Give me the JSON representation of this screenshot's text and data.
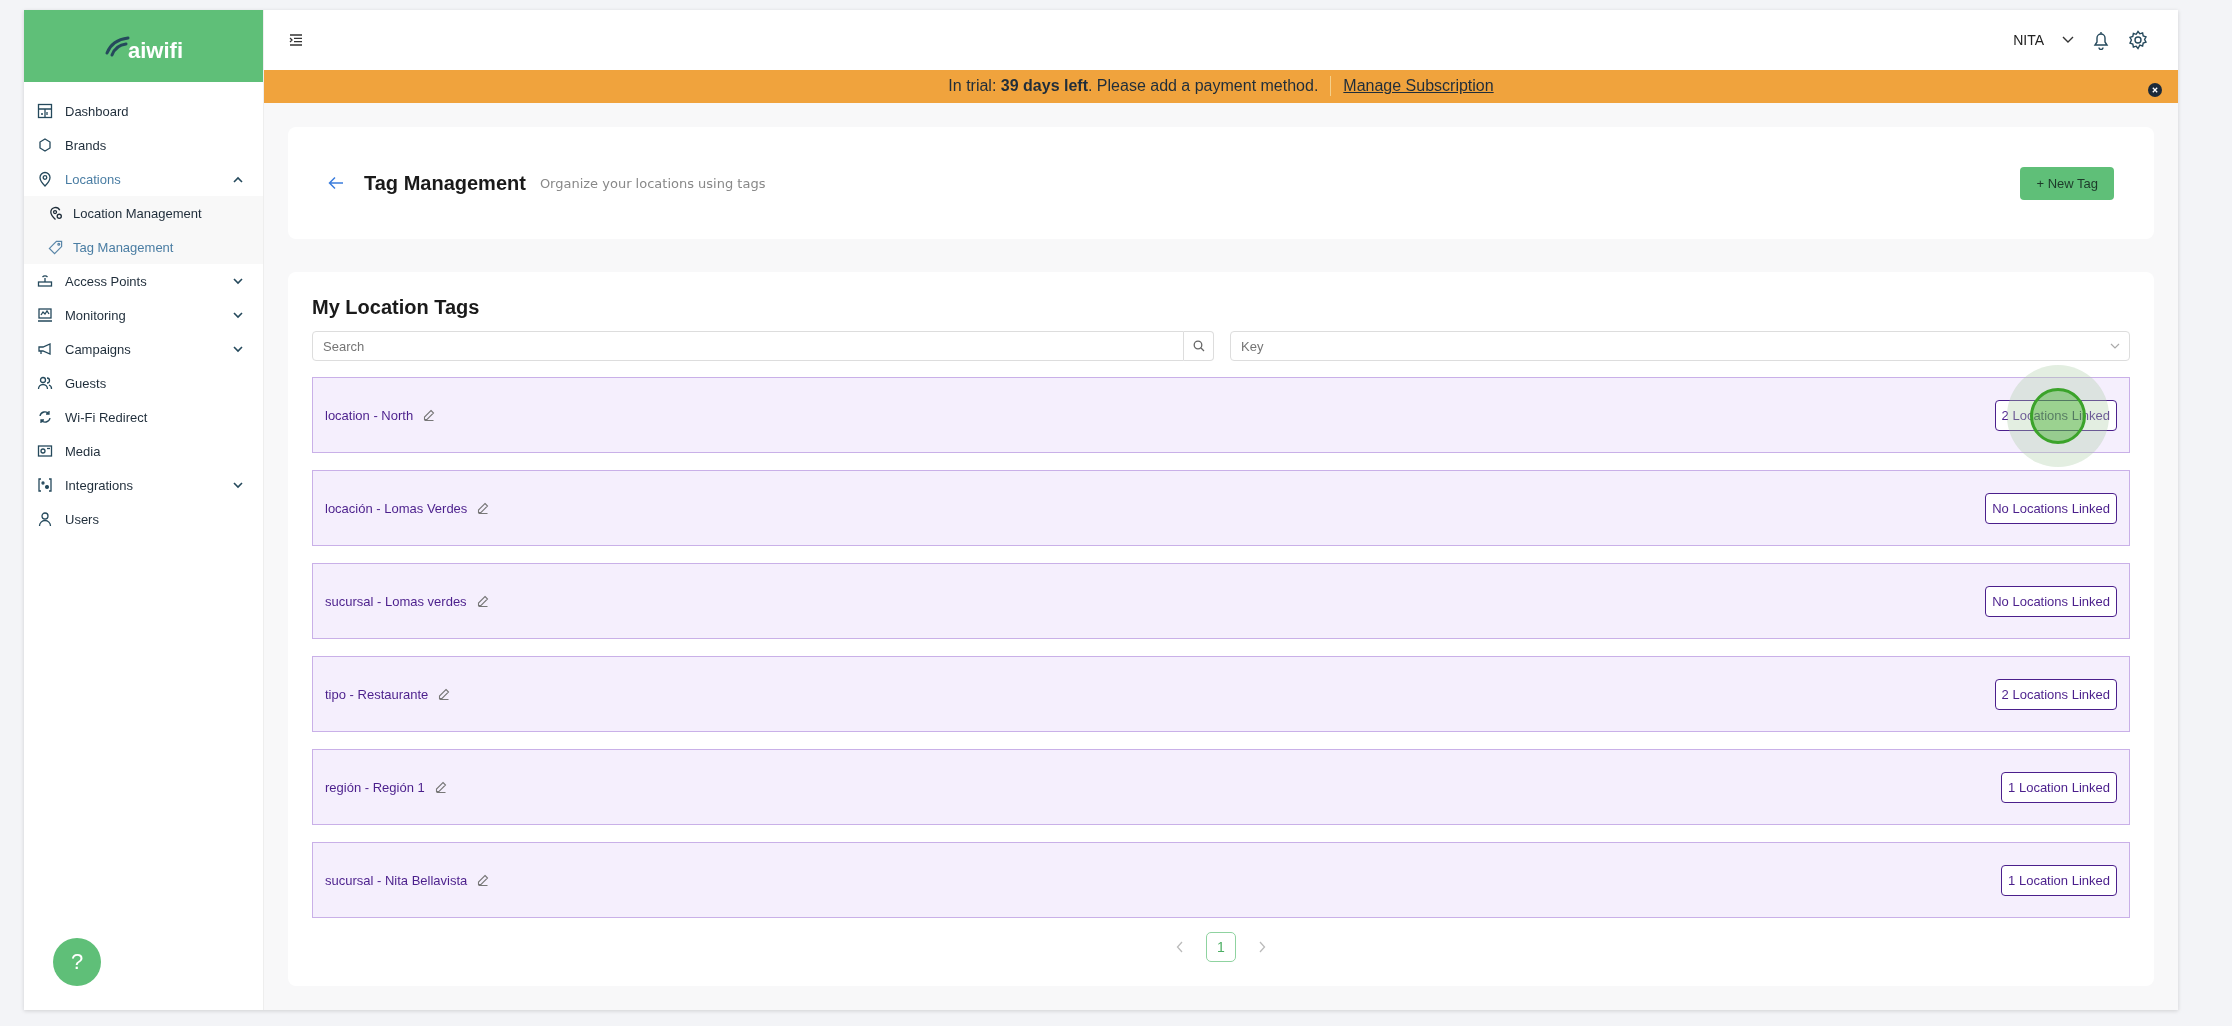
{
  "sidebar": {
    "logo": "aiwifi",
    "items": [
      {
        "label": "Dashboard",
        "selected": false
      },
      {
        "label": "Brands",
        "selected": false
      },
      {
        "label": "Locations",
        "selected": true,
        "expanded": true,
        "children": [
          {
            "label": "Location Management",
            "selected": false
          },
          {
            "label": "Tag Management",
            "selected": true
          }
        ]
      },
      {
        "label": "Access Points",
        "selected": false,
        "expanded": false
      },
      {
        "label": "Monitoring",
        "selected": false,
        "expanded": false
      },
      {
        "label": "Campaigns",
        "selected": false,
        "expanded": false
      },
      {
        "label": "Guests",
        "selected": false
      },
      {
        "label": "Wi-Fi Redirect",
        "selected": false
      },
      {
        "label": "Media",
        "selected": false
      },
      {
        "label": "Integrations",
        "selected": false,
        "expanded": false
      },
      {
        "label": "Users",
        "selected": false
      }
    ],
    "help": "?"
  },
  "topbar": {
    "user": "NITA"
  },
  "banner": {
    "text": "In trial: **39 days left**. Please add a payment method.",
    "link": "Manage Subscription"
  },
  "header": {
    "title": "Tag Management",
    "subtitle": "Organize your locations using tags",
    "button": "+ New Tag"
  },
  "tags": {
    "title": "My Location Tags",
    "search": {
      "placeholder": "Search"
    },
    "key": {
      "placeholder": "Key"
    },
    "rows": [
      {
        "label": "location - North",
        "linked": "2 Locations Linked"
      },
      {
        "label": "locación - Lomas Verdes",
        "linked": "No Locations Linked"
      },
      {
        "label": "sucursal - Lomas verdes",
        "linked": "No Locations Linked"
      },
      {
        "label": "tipo - Restaurante",
        "linked": "2 Locations Linked"
      },
      {
        "label": "región - Región 1",
        "linked": "1 Location Linked"
      },
      {
        "label": "sucursal - Nita Bellavista",
        "linked": "1 Location Linked"
      }
    ],
    "pages": [
      {
        "label": "1",
        "selected": true
      }
    ]
  }
}
